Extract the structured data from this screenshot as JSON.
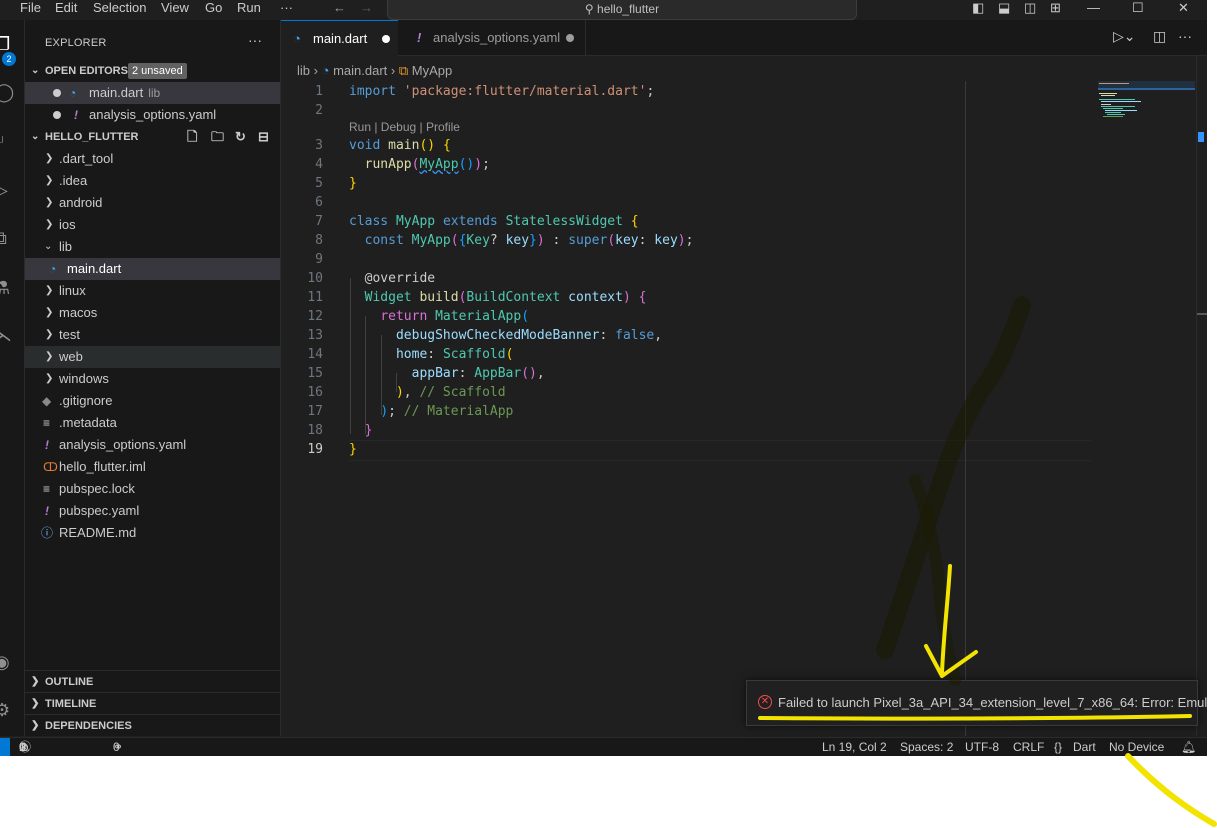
{
  "menu": [
    "File",
    "Edit",
    "Selection",
    "View",
    "Go",
    "Run",
    "···"
  ],
  "command_center": "hello_flutter",
  "explorer": {
    "title": "EXPLORER",
    "open_editors": {
      "label": "OPEN EDITORS",
      "badge": "2 unsaved",
      "items": [
        {
          "name": "main.dart",
          "detail": "lib"
        },
        {
          "name": "analysis_options.yaml"
        }
      ]
    },
    "project": {
      "label": "HELLO_FLUTTER",
      "items": [
        {
          "name": ".dart_tool"
        },
        {
          "name": ".idea"
        },
        {
          "name": "android"
        },
        {
          "name": "ios"
        },
        {
          "name": "lib"
        },
        {
          "name": "main.dart"
        },
        {
          "name": "linux"
        },
        {
          "name": "macos"
        },
        {
          "name": "test"
        },
        {
          "name": "web"
        },
        {
          "name": "windows"
        },
        {
          "name": ".gitignore"
        },
        {
          "name": ".metadata"
        },
        {
          "name": "analysis_options.yaml"
        },
        {
          "name": "hello_flutter.iml"
        },
        {
          "name": "pubspec.lock"
        },
        {
          "name": "pubspec.yaml"
        },
        {
          "name": "README.md"
        }
      ]
    },
    "outline": "OUTLINE",
    "timeline": "TIMELINE",
    "dependencies": "DEPENDENCIES",
    "activity_badge": "2"
  },
  "tabs": [
    {
      "label": "main.dart"
    },
    {
      "label": "analysis_options.yaml"
    }
  ],
  "breadcrumb": {
    "folder": "lib",
    "file": "main.dart",
    "symbol": "MyApp"
  },
  "code": {
    "line_numbers": [
      "1",
      "2",
      "3",
      "4",
      "5",
      "6",
      "7",
      "8",
      "9",
      "10",
      "11",
      "12",
      "13",
      "14",
      "15",
      "16",
      "17",
      "18",
      "19"
    ],
    "codelens": "Run | Debug | Profile",
    "comment_scaffold": "// Scaffold",
    "comment_materialapp": "// MaterialApp"
  },
  "notification": {
    "message": "Failed to launch Pixel_3a_API_34_extension_level_7_x86_64: Error: Emul..."
  },
  "status": {
    "errors": "0",
    "warnings": "0",
    "info": "1",
    "ports": "0",
    "position": "Ln 19, Col 2",
    "spaces": "Spaces: 2",
    "encoding": "UTF-8",
    "eol": "CRLF",
    "language_braces": "{}",
    "language": "Dart",
    "device": "No Device"
  },
  "colors": {
    "accent": "#0078d4",
    "error": "#f14c4c",
    "annotation_yellow": "#f2e400"
  }
}
